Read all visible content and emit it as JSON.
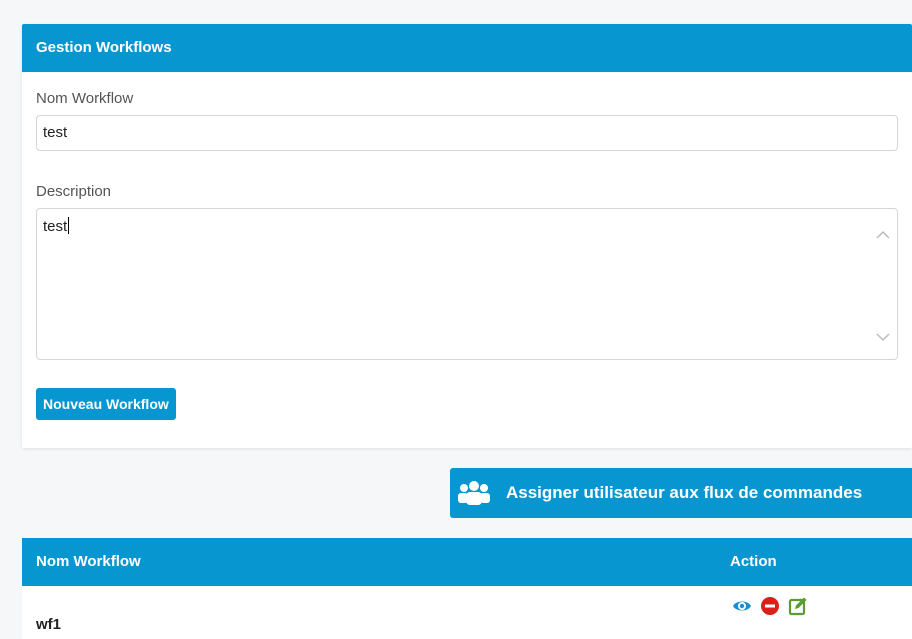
{
  "form_panel": {
    "title": "Gestion Workflows",
    "name_label": "Nom Workflow",
    "name_value": "test",
    "description_label": "Description",
    "description_value": "test",
    "new_button_label": "Nouveau Workflow"
  },
  "assign_button": {
    "label": "Assigner utilisateur aux flux de commandes",
    "icon": "users-icon"
  },
  "table": {
    "columns": [
      "Nom Workflow",
      "Action"
    ],
    "rows": [
      {
        "name": "wf1",
        "actions": [
          "eye-icon",
          "delete-icon",
          "edit-icon"
        ]
      }
    ]
  },
  "colors": {
    "primary": "#0896d1",
    "view": "#1a8fd0",
    "delete": "#d9201b",
    "edit": "#5a9b32"
  }
}
